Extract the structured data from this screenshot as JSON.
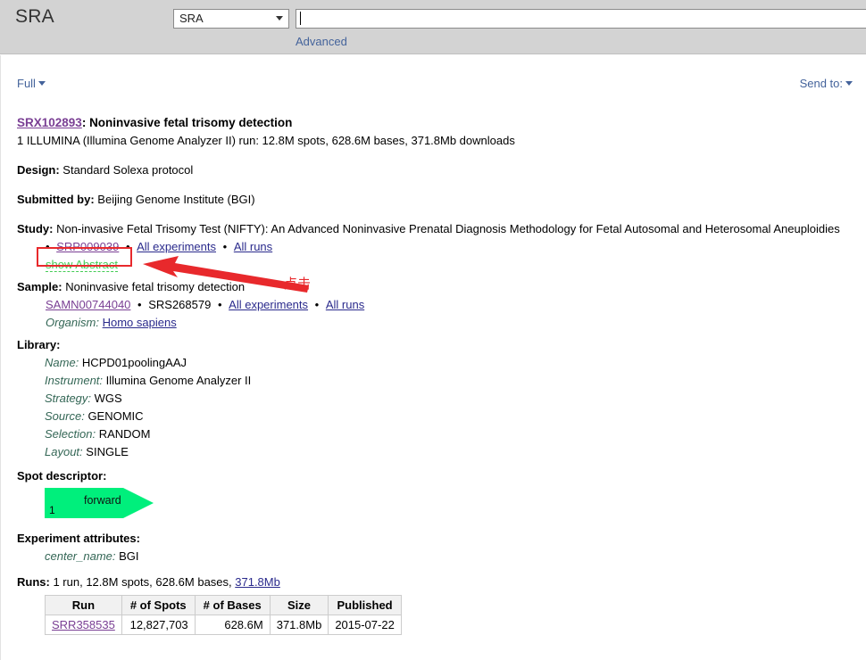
{
  "topbar": {
    "brand": "SRA",
    "database_selected": "SRA",
    "database_options": [
      "SRA"
    ],
    "search_value": "",
    "search_placeholder": "",
    "advanced_label": "Advanced"
  },
  "displaybar": {
    "display_mode": "Full",
    "send_to": "Send to:"
  },
  "record": {
    "accession": "SRX102893",
    "title_sep": ": ",
    "title": "Noninvasive fetal trisomy detection",
    "summary": "1 ILLUMINA (Illumina Genome Analyzer II) run: 12.8M spots, 628.6M bases, 371.8Mb downloads",
    "design_label": "Design:",
    "design_value": "Standard Solexa protocol",
    "submitted_label": "Submitted by:",
    "submitted_value": "Beijing Genome Institute (BGI)",
    "study_label": "Study:",
    "study_value": "Non-invasive Fetal Trisomy Test (NIFTY): An Advanced Noninvasive Prenatal Diagnosis Methodology for Fetal Autosomal and Heterosomal Aneuploidies",
    "study_bullet": "•",
    "study_accession": "SRP009039",
    "study_all_experiments": "All experiments",
    "study_all_runs": "All runs",
    "show_abstract": "show Abstract",
    "sample_label": "Sample:",
    "sample_value": "Noninvasive fetal trisomy detection",
    "sample_biosample": "SAMN00744040",
    "sample_srs": "SRS268579",
    "sample_all_experiments": "All experiments",
    "sample_all_runs": "All runs",
    "organism_label": "Organism:",
    "organism_value": "Homo sapiens",
    "library_label": "Library:",
    "library": [
      {
        "label": "Name:",
        "value": "HCPD01poolingAAJ"
      },
      {
        "label": "Instrument:",
        "value": "Illumina Genome Analyzer II"
      },
      {
        "label": "Strategy:",
        "value": "WGS"
      },
      {
        "label": "Source:",
        "value": "GENOMIC"
      },
      {
        "label": "Selection:",
        "value": "RANDOM"
      },
      {
        "label": "Layout:",
        "value": "SINGLE"
      }
    ],
    "spot_descriptor_label": "Spot descriptor:",
    "spot_descriptor": {
      "index": "1",
      "read_label": "forward",
      "color": "#00ef7c"
    },
    "experiment_attributes_label": "Experiment attributes:",
    "experiment_attributes": [
      {
        "label": "center_name:",
        "value": "BGI"
      }
    ],
    "runs_label": "Runs:",
    "runs_summary_prefix": "1 run, 12.8M spots, 628.6M bases, ",
    "runs_summary_link": "371.8Mb"
  },
  "runs_table": {
    "columns": [
      "Run",
      "# of Spots",
      "# of Bases",
      "Size",
      "Published"
    ],
    "rows": [
      {
        "run": "SRR358535",
        "spots": "12,827,703",
        "bases": "628.6M",
        "size": "371.8Mb",
        "published": "2015-07-22"
      }
    ]
  },
  "annotations": {
    "highlight_target": "SRP009039",
    "callout_text": "点击",
    "color": "#e8292c"
  }
}
